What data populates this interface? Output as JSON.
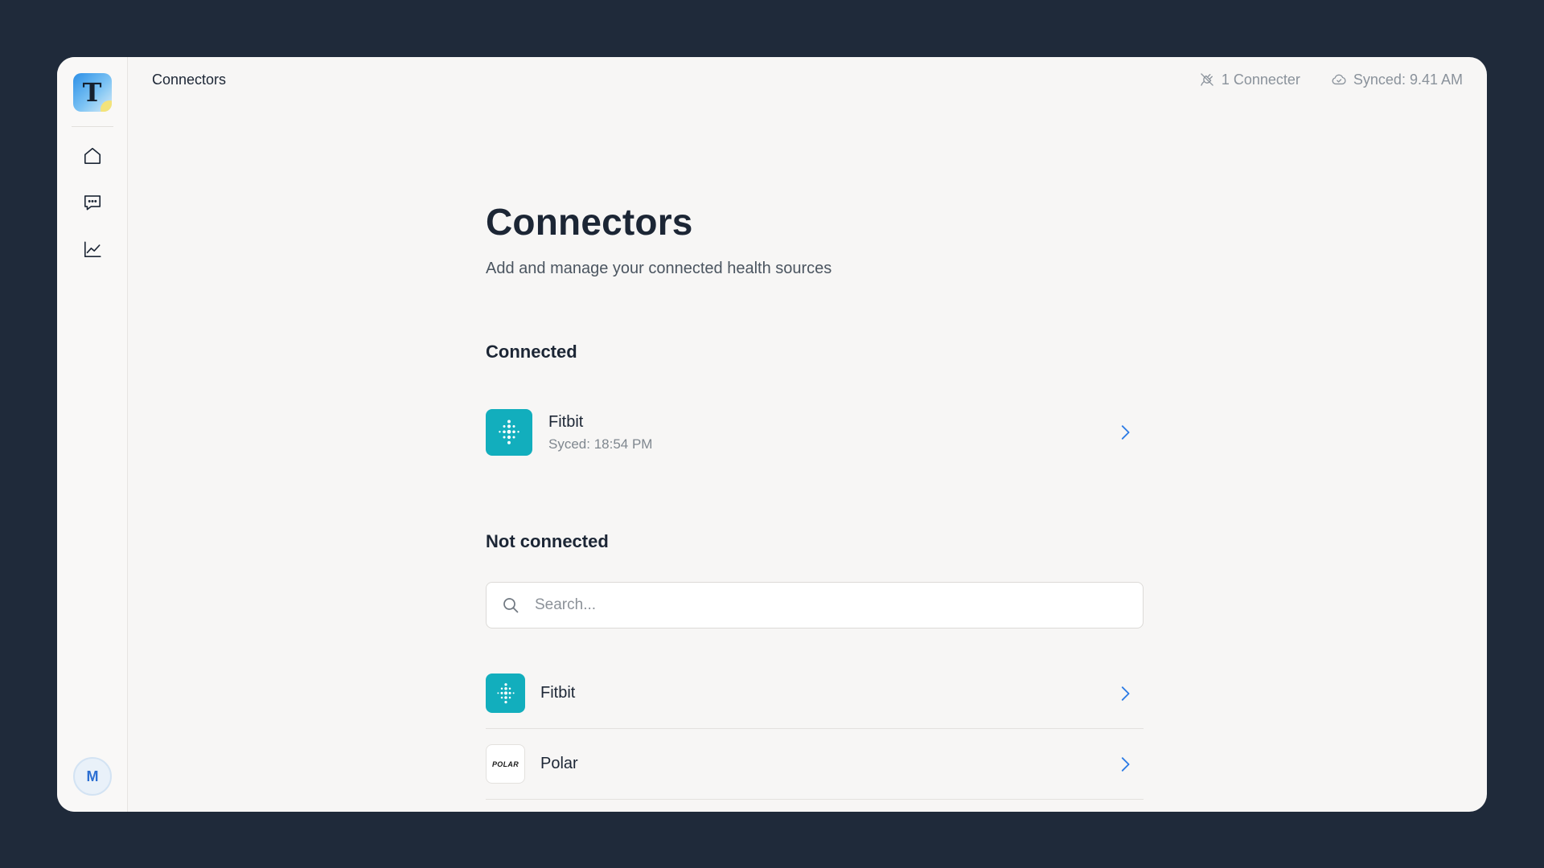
{
  "app": {
    "logo_letter": "T",
    "avatar_initial": "M"
  },
  "sidebar": {
    "items": [
      {
        "name": "home",
        "icon": "home-icon"
      },
      {
        "name": "messages",
        "icon": "chat-icon"
      },
      {
        "name": "analytics",
        "icon": "line-chart-icon"
      }
    ]
  },
  "topbar": {
    "title": "Connectors",
    "connecter_count": "1 Connecter",
    "synced": "Synced: 9.41 AM"
  },
  "page": {
    "title": "Connectors",
    "subtitle": "Add and manage your connected health sources"
  },
  "connected": {
    "heading": "Connected",
    "items": [
      {
        "name": "Fitbit",
        "status": "Syced: 18:54 PM",
        "icon": "fitbit-icon"
      }
    ]
  },
  "not_connected": {
    "heading": "Not connected",
    "search_placeholder": "Search...",
    "items": [
      {
        "name": "Fitbit",
        "icon": "fitbit-icon"
      },
      {
        "name": "Polar",
        "icon": "polar-icon",
        "logo_text": "POLAR"
      }
    ]
  },
  "colors": {
    "background": "#1f2a3a",
    "window": "#f7f6f5",
    "accent": "#2c7be5",
    "fitbit": "#12aebd"
  }
}
